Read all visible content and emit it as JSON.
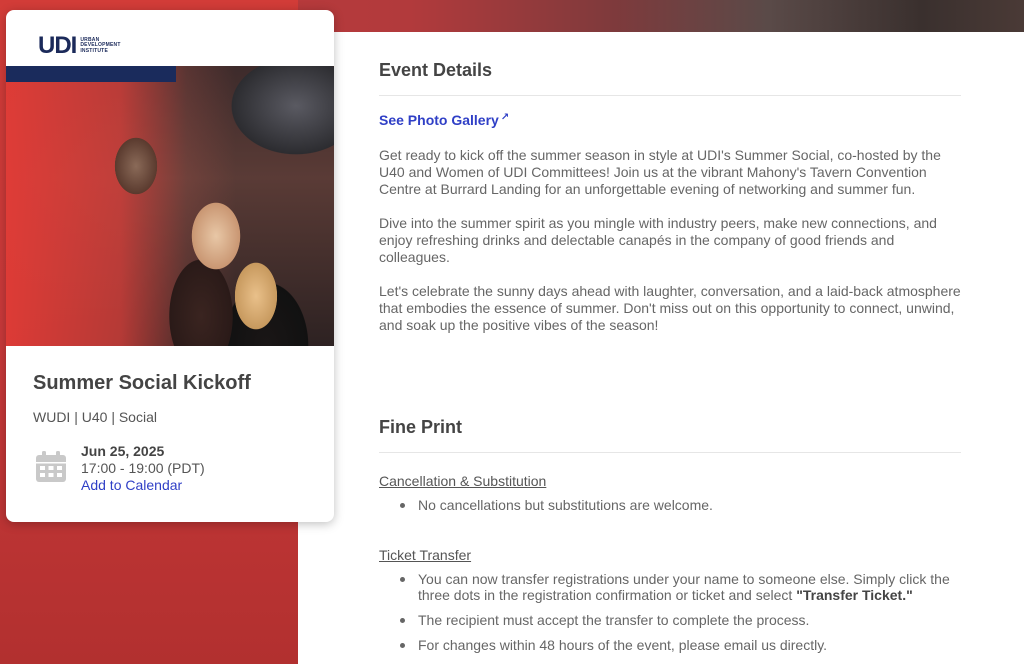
{
  "card": {
    "logo_text": "UDI",
    "logo_subtitle_lines": [
      "URBAN",
      "DEVELOPMENT",
      "INSTITUTE"
    ],
    "title": "Summer Social Kickoff",
    "tags": "WUDI | U40 | Social",
    "date": "Jun 25, 2025",
    "time": "17:00 - 19:00 (PDT)",
    "add_to_calendar": "Add to Calendar"
  },
  "details": {
    "heading": "Event Details",
    "gallery_link": "See Photo Gallery",
    "paragraphs": [
      "Get ready to kick off the summer season in style at UDI's Summer Social, co-hosted by the U40 and Women of UDI Committees! Join us at the vibrant Mahony's Tavern Convention Centre at Burrard Landing for an unforgettable evening of networking and summer fun.",
      "Dive into the summer spirit as you mingle with industry peers, make new connections, and enjoy refreshing drinks and delectable canapés in the company of good friends and colleagues.",
      "Let's celebrate the sunny days ahead with laughter, conversation, and a laid-back atmosphere that embodies the essence of summer. Don't miss out on this opportunity to connect, unwind, and soak up the positive vibes of the season!"
    ]
  },
  "fine_print": {
    "heading": "Fine Print",
    "cancellation_heading": "Cancellation & Substitution",
    "cancellation_items": [
      "No cancellations but substitutions are welcome."
    ],
    "transfer_heading": "Ticket Transfer",
    "transfer_item_1_text": "You can now transfer registrations under your name to someone else. Simply click the three dots in the registration confirmation or ticket and select ",
    "transfer_item_1_bold": "\"Transfer Ticket.\"",
    "transfer_item_2": "The recipient must accept the transfer to complete the process.",
    "transfer_item_3": "For changes within 48 hours of the event, please email us directly."
  },
  "colors": {
    "brand_navy": "#1a2b5c",
    "link_blue": "#2f3fc6",
    "accent_red": "#d23c38"
  },
  "icons": {
    "calendar": "calendar-icon",
    "external_link": "external-link-icon"
  }
}
